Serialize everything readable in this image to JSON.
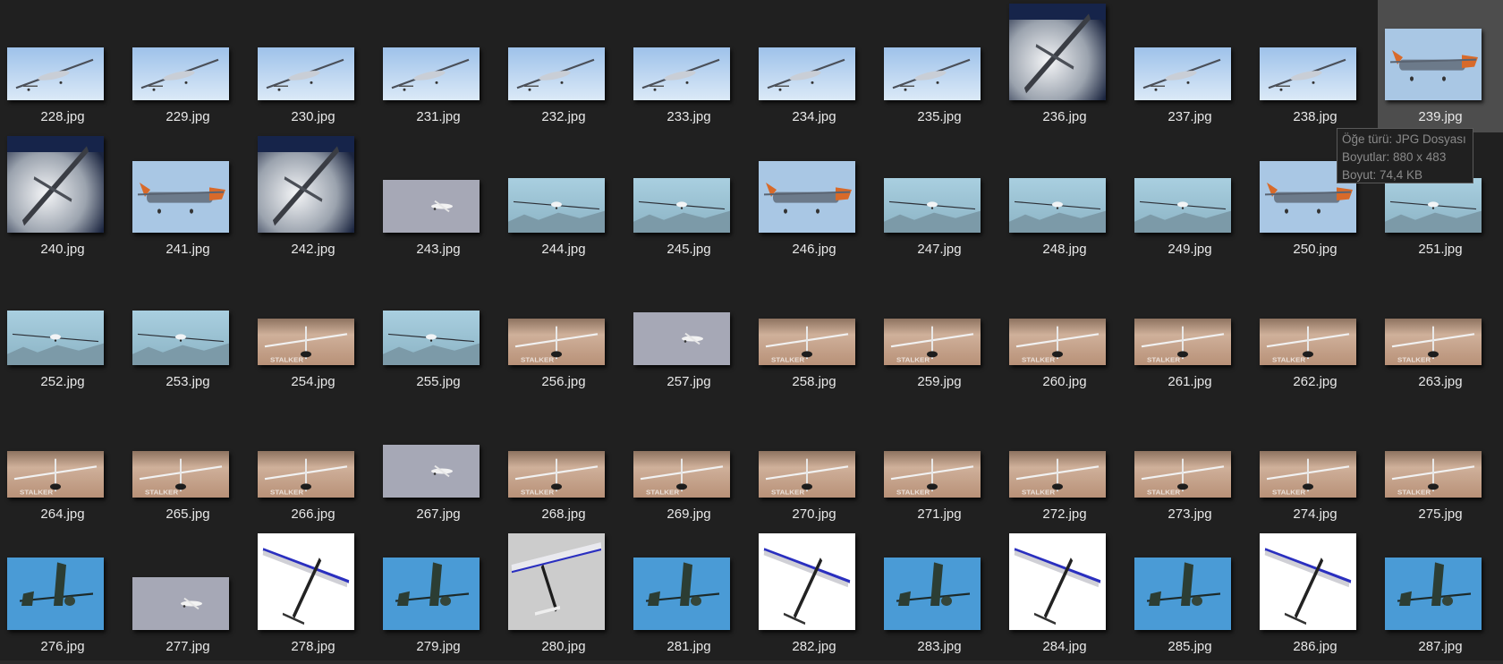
{
  "files": [
    {
      "name": "228.jpg",
      "thumb": "drone-sky"
    },
    {
      "name": "229.jpg",
      "thumb": "drone-sky"
    },
    {
      "name": "230.jpg",
      "thumb": "drone-sky"
    },
    {
      "name": "231.jpg",
      "thumb": "drone-sky"
    },
    {
      "name": "232.jpg",
      "thumb": "drone-sky"
    },
    {
      "name": "233.jpg",
      "thumb": "drone-sky"
    },
    {
      "name": "234.jpg",
      "thumb": "drone-sky"
    },
    {
      "name": "235.jpg",
      "thumb": "drone-sky"
    },
    {
      "name": "236.jpg",
      "thumb": "drone-clouds"
    },
    {
      "name": "237.jpg",
      "thumb": "drone-sky"
    },
    {
      "name": "238.jpg",
      "thumb": "drone-sky"
    },
    {
      "name": "239.jpg",
      "thumb": "drone-orange"
    },
    {
      "name": "240.jpg",
      "thumb": "drone-clouds"
    },
    {
      "name": "241.jpg",
      "thumb": "drone-orange"
    },
    {
      "name": "242.jpg",
      "thumb": "drone-clouds"
    },
    {
      "name": "243.jpg",
      "thumb": "small-plane"
    },
    {
      "name": "244.jpg",
      "thumb": "drone-mountain"
    },
    {
      "name": "245.jpg",
      "thumb": "drone-mountain"
    },
    {
      "name": "246.jpg",
      "thumb": "drone-orange"
    },
    {
      "name": "247.jpg",
      "thumb": "drone-mountain"
    },
    {
      "name": "248.jpg",
      "thumb": "drone-mountain"
    },
    {
      "name": "249.jpg",
      "thumb": "drone-mountain"
    },
    {
      "name": "250.jpg",
      "thumb": "drone-orange"
    },
    {
      "name": "251.jpg",
      "thumb": "drone-mountain"
    },
    {
      "name": "252.jpg",
      "thumb": "drone-mountain"
    },
    {
      "name": "253.jpg",
      "thumb": "drone-mountain"
    },
    {
      "name": "254.jpg",
      "thumb": "drone-sand"
    },
    {
      "name": "255.jpg",
      "thumb": "drone-mountain"
    },
    {
      "name": "256.jpg",
      "thumb": "drone-sand"
    },
    {
      "name": "257.jpg",
      "thumb": "small-plane"
    },
    {
      "name": "258.jpg",
      "thumb": "drone-sand"
    },
    {
      "name": "259.jpg",
      "thumb": "drone-sand"
    },
    {
      "name": "260.jpg",
      "thumb": "drone-sand"
    },
    {
      "name": "261.jpg",
      "thumb": "drone-sand"
    },
    {
      "name": "262.jpg",
      "thumb": "drone-sand"
    },
    {
      "name": "263.jpg",
      "thumb": "drone-sand"
    },
    {
      "name": "264.jpg",
      "thumb": "drone-sand"
    },
    {
      "name": "265.jpg",
      "thumb": "drone-sand"
    },
    {
      "name": "266.jpg",
      "thumb": "drone-sand"
    },
    {
      "name": "267.jpg",
      "thumb": "small-plane"
    },
    {
      "name": "268.jpg",
      "thumb": "drone-sand"
    },
    {
      "name": "269.jpg",
      "thumb": "drone-sand"
    },
    {
      "name": "270.jpg",
      "thumb": "drone-sand"
    },
    {
      "name": "271.jpg",
      "thumb": "drone-sand"
    },
    {
      "name": "272.jpg",
      "thumb": "drone-sand"
    },
    {
      "name": "273.jpg",
      "thumb": "drone-sand"
    },
    {
      "name": "274.jpg",
      "thumb": "drone-sand"
    },
    {
      "name": "275.jpg",
      "thumb": "drone-sand"
    },
    {
      "name": "276.jpg",
      "thumb": "glider-blue"
    },
    {
      "name": "277.jpg",
      "thumb": "small-plane"
    },
    {
      "name": "278.jpg",
      "thumb": "glider-white"
    },
    {
      "name": "279.jpg",
      "thumb": "glider-blue"
    },
    {
      "name": "280.jpg",
      "thumb": "glider-grey"
    },
    {
      "name": "281.jpg",
      "thumb": "glider-blue"
    },
    {
      "name": "282.jpg",
      "thumb": "glider-white"
    },
    {
      "name": "283.jpg",
      "thumb": "glider-blue"
    },
    {
      "name": "284.jpg",
      "thumb": "glider-white"
    },
    {
      "name": "285.jpg",
      "thumb": "glider-blue"
    },
    {
      "name": "286.jpg",
      "thumb": "glider-white"
    },
    {
      "name": "287.jpg",
      "thumb": "glider-blue"
    }
  ],
  "hovered_file": "239.jpg",
  "tooltip": {
    "type_line": "Öğe türü: JPG Dosyası",
    "dims_line": "Boyutlar: 880 x 483",
    "size_line": "Boyut: 74,4 KB"
  },
  "colors": {
    "background": "#202020",
    "hover": "#4d4d4d",
    "label": "#e8e8e8",
    "tooltip_text": "#8a8a8a"
  }
}
